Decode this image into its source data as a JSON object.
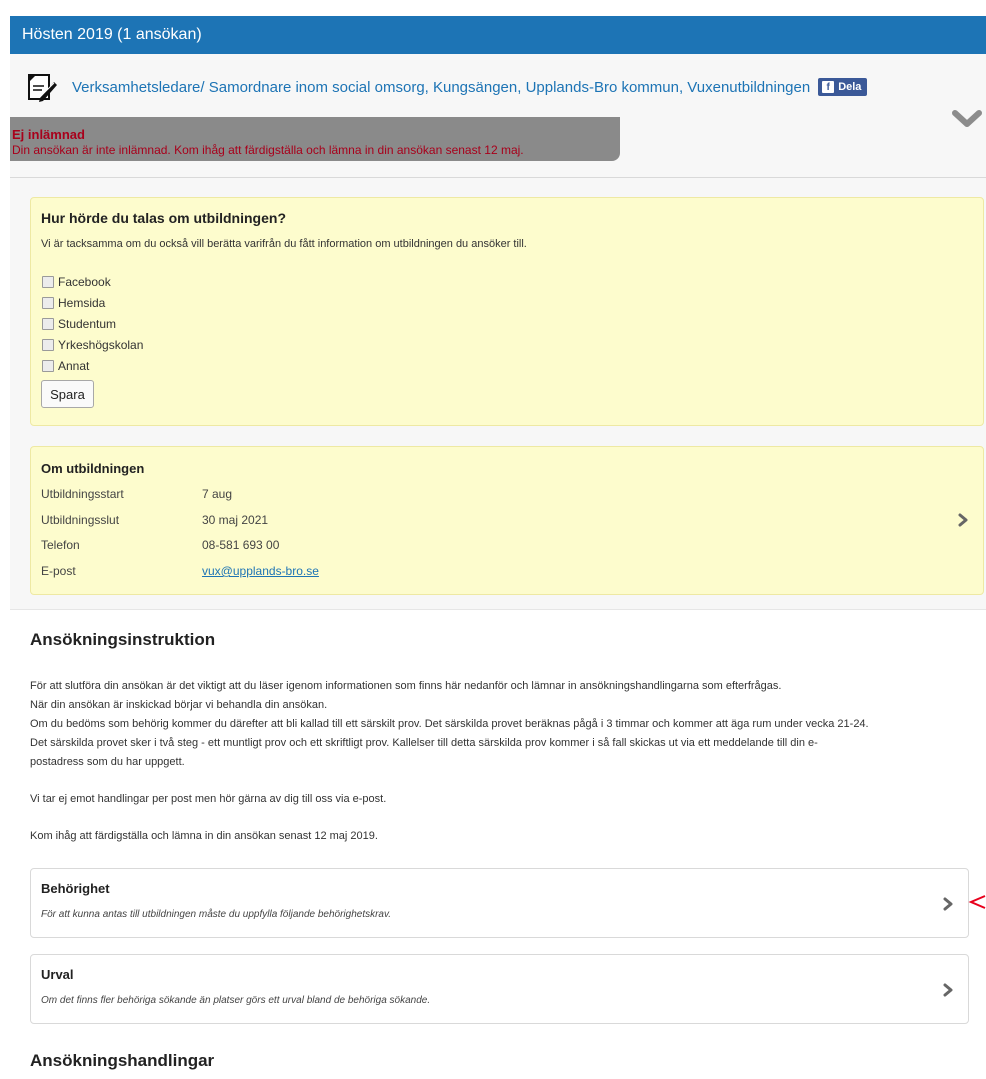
{
  "header": {
    "title": "Hösten 2019 (1 ansökan)"
  },
  "application": {
    "icon": "document-pen-icon",
    "course_link": "Verksamhetsledare/ Samordnare inom social omsorg, Kungsängen, Upplands-Bro kommun, Vuxenutbildningen",
    "share_label": "Dela",
    "status_title": "Ej inlämnad",
    "status_text": "Din ansökan är inte inlämnad. Kom ihåg att färdigställa och lämna in din ansökan senast 12 maj."
  },
  "survey": {
    "title": "Hur hörde du talas om utbildningen?",
    "description": "Vi är tacksamma om du också vill berätta varifrån du fått information om utbildningen du ansöker till.",
    "options": [
      "Facebook",
      "Hemsida",
      "Studentum",
      "Yrkeshögskolan",
      "Annat"
    ],
    "save_label": "Spara"
  },
  "about": {
    "title": "Om utbildningen",
    "rows": [
      {
        "label": "Utbildningsstart",
        "value": "7 aug"
      },
      {
        "label": "Utbildningsslut",
        "value": "30 maj 2021"
      },
      {
        "label": "Telefon",
        "value": "08-581 693 00"
      },
      {
        "label": "E-post",
        "value": "vux@upplands-bro.se"
      }
    ]
  },
  "instructions": {
    "title": "Ansökningsinstruktion",
    "lines": [
      "För att slutföra din ansökan är det viktigt att du läser igenom informationen som finns här nedanför och lämnar in ansökningshandlingarna som efterfrågas.",
      "När din ansökan är inskickad börjar vi behandla din ansökan.",
      "Om du bedöms som behörig kommer du därefter att bli kallad till ett särskilt prov. Det särskilda provet beräknas pågå i 3 timmar och kommer att äga rum under vecka 21-24.",
      "Det särskilda provet sker i två steg - ett muntligt prov och ett skriftligt prov. Kallelser till detta särskilda prov kommer i så fall skickas ut via ett meddelande till din e-",
      "postadress som du har uppgett.",
      "Vi tar ej emot handlingar per post men hör gärna av dig till oss via e-post.",
      "Kom ihåg att färdigställa och lämna in din ansökan senast 12 maj 2019."
    ],
    "accordions": [
      {
        "title": "Behörighet",
        "subtitle": "För att kunna antas till utbildningen måste du uppfylla följande behörighetskrav."
      },
      {
        "title": "Urval",
        "subtitle": "Om det finns fler behöriga sökande än platser görs ett urval bland de behöriga sökande."
      }
    ]
  },
  "documents": {
    "title": "Ansökningshandlingar"
  },
  "colors": {
    "header": "#1d74b5",
    "status": "#a8001b",
    "info_box": "#fdfccd",
    "annotation_arrow": "#e8001c"
  }
}
